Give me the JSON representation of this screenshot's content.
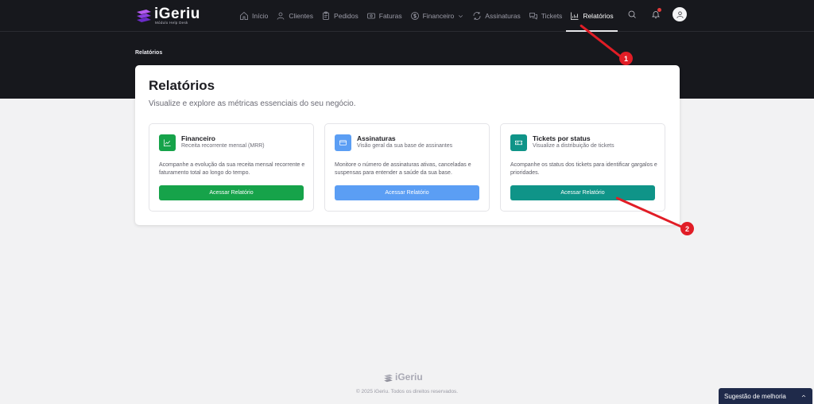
{
  "brand": {
    "name": "iGeriu",
    "tagline": "Módulo Help Desk",
    "accent": "#8b3fe0"
  },
  "nav": [
    {
      "label": "Início",
      "icon": "home-icon",
      "active": false
    },
    {
      "label": "Clientes",
      "icon": "user-icon",
      "active": false
    },
    {
      "label": "Pedidos",
      "icon": "clipboard-icon",
      "active": false
    },
    {
      "label": "Faturas",
      "icon": "invoice-icon",
      "active": false
    },
    {
      "label": "Financeiro",
      "icon": "dollar-icon",
      "active": false,
      "dropdown": true
    },
    {
      "label": "Assinaturas",
      "icon": "refresh-icon",
      "active": false
    },
    {
      "label": "Tickets",
      "icon": "chat-icon",
      "active": false
    },
    {
      "label": "Relatórios",
      "icon": "chart-icon",
      "active": true
    }
  ],
  "topbar": {
    "icons": [
      "search-icon",
      "bell-icon",
      "user-avatar-icon"
    ]
  },
  "breadcrumb": "Relatórios",
  "page": {
    "title": "Relatórios",
    "subtitle": "Visualize e explore as métricas essenciais do seu negócio."
  },
  "cards": [
    {
      "title": "Financeiro",
      "subtitle": "Receita recorrente mensal (MRR)",
      "description": "Acompanhe a evolução da sua receita mensal recorrente e faturamento total ao longo do tempo.",
      "button": "Acessar Relatório",
      "icon": "trend-chart-icon",
      "color": "#16a34a"
    },
    {
      "title": "Assinaturas",
      "subtitle": "Visão geral da sua base de assinantes",
      "description": "Monitore o número de assinaturas ativas, canceladas e suspensas para entender a saúde da sua base.",
      "button": "Acessar Relatório",
      "icon": "credit-card-icon",
      "color": "#5b9ef4"
    },
    {
      "title": "Tickets por status",
      "subtitle": "Visualize a distribuição de tickets",
      "description": "Acompanhe os status dos tickets para identificar gargalos e prioridades.",
      "button": "Acessar Relatório",
      "icon": "ticket-icon",
      "color": "#0f9488"
    }
  ],
  "annotations": [
    "1",
    "2"
  ],
  "footer": {
    "brand": "iGeriu",
    "copyright": "© 2025 iGeriu. Todos os direitos reservados."
  },
  "suggestion": {
    "label": "Sugestão de melhoria"
  }
}
